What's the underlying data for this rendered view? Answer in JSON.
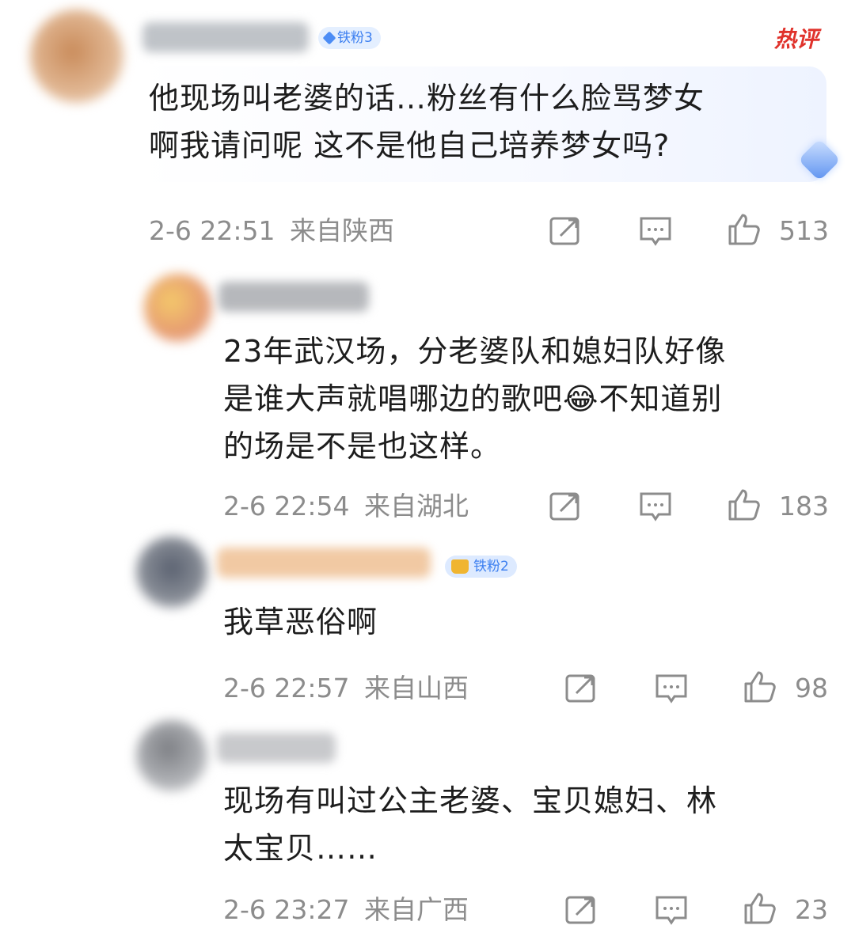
{
  "hot_label": "热评",
  "comments": [
    {
      "badge": "铁粉3",
      "text_lines": [
        "他现场叫老婆的话…粉丝有什么脸骂梦女",
        "啊我请问呢 这不是他自己培养梦女吗?"
      ],
      "time": "2-6 22:51",
      "location": "来自陕西",
      "likes": "513"
    },
    {
      "text_lines": [
        "23年武汉场，分老婆队和媳妇队好像",
        "是谁大声就唱哪边的歌吧😂不知道别",
        "的场是不是也这样。"
      ],
      "time": "2-6 22:54",
      "location": "来自湖北",
      "likes": "183"
    },
    {
      "badge": "铁粉2",
      "text_lines": [
        "我草恶俗啊"
      ],
      "time": "2-6 22:57",
      "location": "来自山西",
      "likes": "98"
    },
    {
      "text_lines": [
        "现场有叫过公主老婆、宝贝媳妇、林",
        "太宝贝……"
      ],
      "time": "2-6 23:27",
      "location": "来自广西",
      "likes": "23"
    }
  ],
  "icons": {
    "share": "share-icon",
    "comment": "comment-icon",
    "like": "thumbs-up-icon"
  }
}
